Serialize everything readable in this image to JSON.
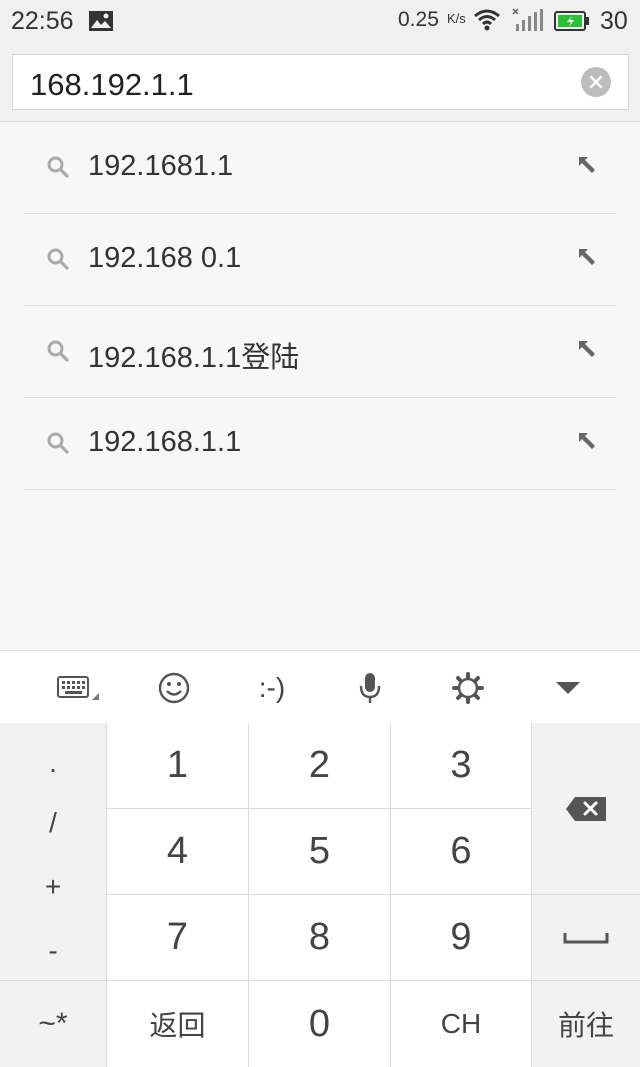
{
  "status_bar": {
    "time": "22:56",
    "speed": "0.25",
    "speed_unit": "K/s",
    "battery": "30",
    "icons": [
      "image-icon",
      "wifi-icon",
      "signal-icon",
      "battery-icon"
    ]
  },
  "address_bar": {
    "value": "168.192.1.1"
  },
  "suggestions": [
    {
      "text": "192.1681.1"
    },
    {
      "text": "192.168 0.1"
    },
    {
      "text": "192.168.1.1登陆"
    },
    {
      "text": "192.168.1.1"
    }
  ],
  "keyboard_toolbar": {
    "items": [
      "keyboard-icon",
      "emoji-icon",
      "emoticon",
      "microphone-icon",
      "settings-icon",
      "collapse-icon"
    ],
    "emoticon_label": ":-)"
  },
  "keypad": {
    "symbols": [
      ".",
      "/",
      "+",
      "-"
    ],
    "digits": [
      "1",
      "2",
      "3",
      "4",
      "5",
      "6",
      "7",
      "8",
      "9"
    ],
    "bottom_left": "~*",
    "back_label": "返回",
    "zero": "0",
    "lang_label": "CH",
    "go_label": "前往",
    "colors": {
      "key_bg": "#ffffff",
      "side_key_bg": "#f2f2f2",
      "battery_green": "#2bbf3a"
    }
  }
}
